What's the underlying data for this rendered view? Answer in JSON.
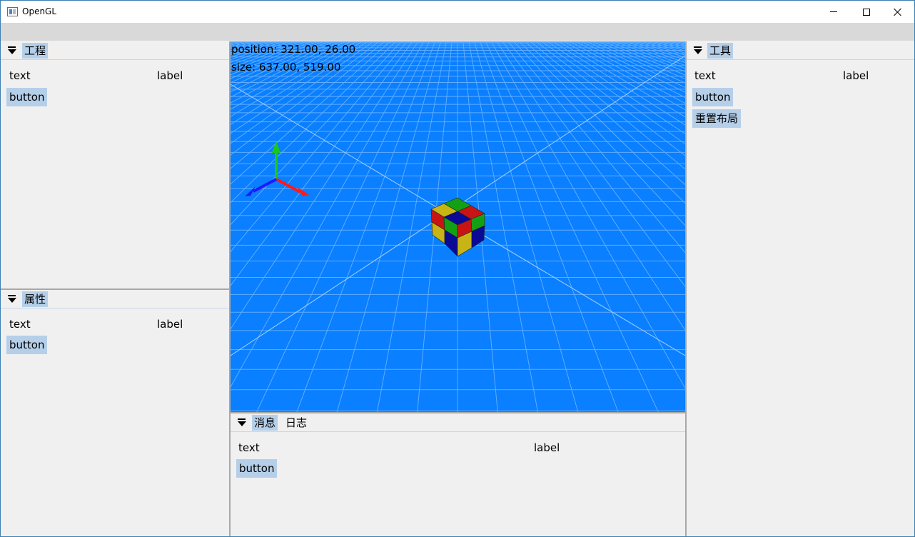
{
  "window": {
    "title": "OpenGL",
    "controls": {
      "minimize": "minimize-icon",
      "maximize": "maximize-icon",
      "close": "close-icon"
    }
  },
  "panels": {
    "project": {
      "tab": "工程",
      "text_label": "text",
      "label_value": "label",
      "button_label": "button"
    },
    "properties": {
      "tab": "属性",
      "text_label": "text",
      "label_value": "label",
      "button_label": "button"
    },
    "tools": {
      "tab": "工具",
      "text_label": "text",
      "label_value": "label",
      "button_label": "button",
      "reset_layout_label": "重置布局"
    },
    "messages": {
      "tabs": [
        "消息",
        "日志"
      ],
      "text_label": "text",
      "label_value": "label",
      "button_label": "button"
    }
  },
  "viewport": {
    "position_text": "position: 321.00, 26.00",
    "size_text": "size: 637.00, 519.00",
    "background_color": "#0a7fff",
    "axes": {
      "x_color": "#ff1a1a",
      "y_color": "#19c819",
      "z_color": "#1a1aff"
    },
    "cube_colors": [
      "#c81414",
      "#c8b414",
      "#14a014",
      "#0a0a96"
    ]
  },
  "colors": {
    "accent": "#b5cfe9",
    "panel_bg": "#f0f0f0",
    "menubar_bg": "#d9d9d9"
  }
}
